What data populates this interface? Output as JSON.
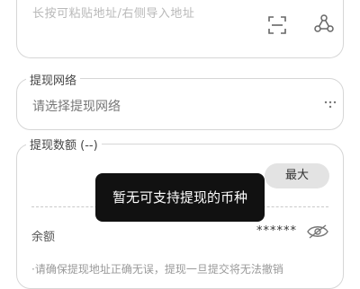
{
  "address": {
    "placeholder": "长按可粘贴地址/右侧导入地址",
    "icons": [
      "scan-icon",
      "import-address-icon"
    ]
  },
  "network": {
    "legend": "提现网络",
    "placeholder": "请选择提现网络"
  },
  "amount": {
    "legend": "提现数额 (--)",
    "max_label": "最大",
    "balance_label": "余额",
    "balance_value": "******",
    "faded_note": "·请确保提现地址正确无误，提现一旦提交将无法撤销"
  },
  "toast": {
    "message": "暂无可支持提现的币种"
  },
  "colors": {
    "border": "#d6d6d6",
    "placeholder": "#b9b9b9",
    "max_button_bg": "#e3e3e3",
    "toast_bg": "#111111"
  }
}
